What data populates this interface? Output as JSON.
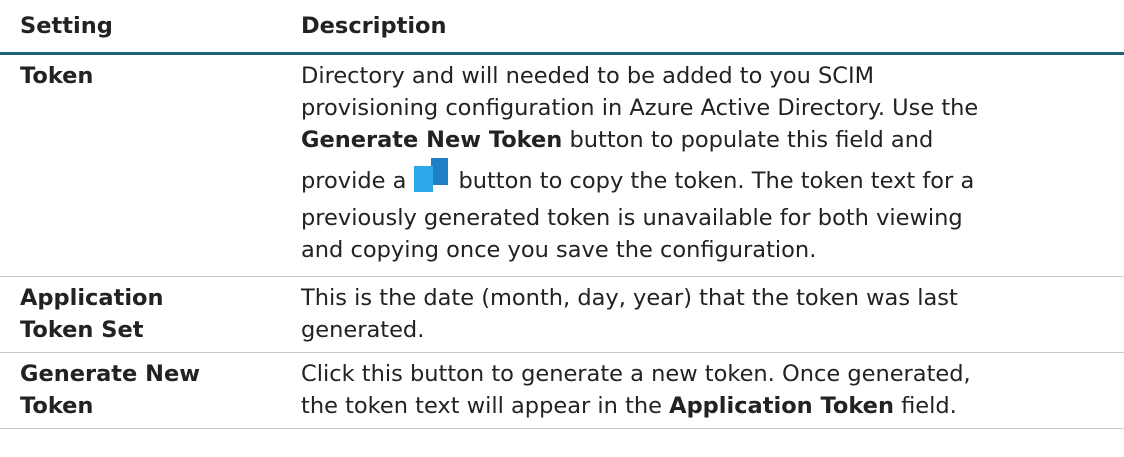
{
  "header": {
    "setting": "Setting",
    "description": "Description"
  },
  "rows": [
    {
      "setting": "Token",
      "desc": {
        "l1": "Directory and will needed to be added to you SCIM",
        "l2": "provisioning configuration in Azure Active Directory. Use the",
        "l3_bold": "Generate New Token",
        "l3_rest": " button to populate this field and",
        "l4_pre": "provide a",
        "l4_icon": "copy-icon",
        "l4_post": "button to copy the token. The token text for a",
        "l5": "previously generated token is unavailable for both viewing",
        "l6": "and copying once you save the configuration."
      }
    },
    {
      "setting_l1": "Application",
      "setting_l2": "Token Set",
      "desc_l1": "This is the date (month, day, year) that the token was last",
      "desc_l2": "generated."
    },
    {
      "setting_l1": "Generate New",
      "setting_l2": "Token",
      "desc_l1": "Click this button to generate a new token. Once generated,",
      "desc_l2_pre": "the token text will appear in the ",
      "desc_l2_bold": "Application Token",
      "desc_l2_post": " field."
    }
  ],
  "colors": {
    "header_rule": "#1d5f73",
    "row_rule": "#c9c9c9",
    "icon_front": "#2aa8e8",
    "icon_back": "#1f7fc4"
  }
}
